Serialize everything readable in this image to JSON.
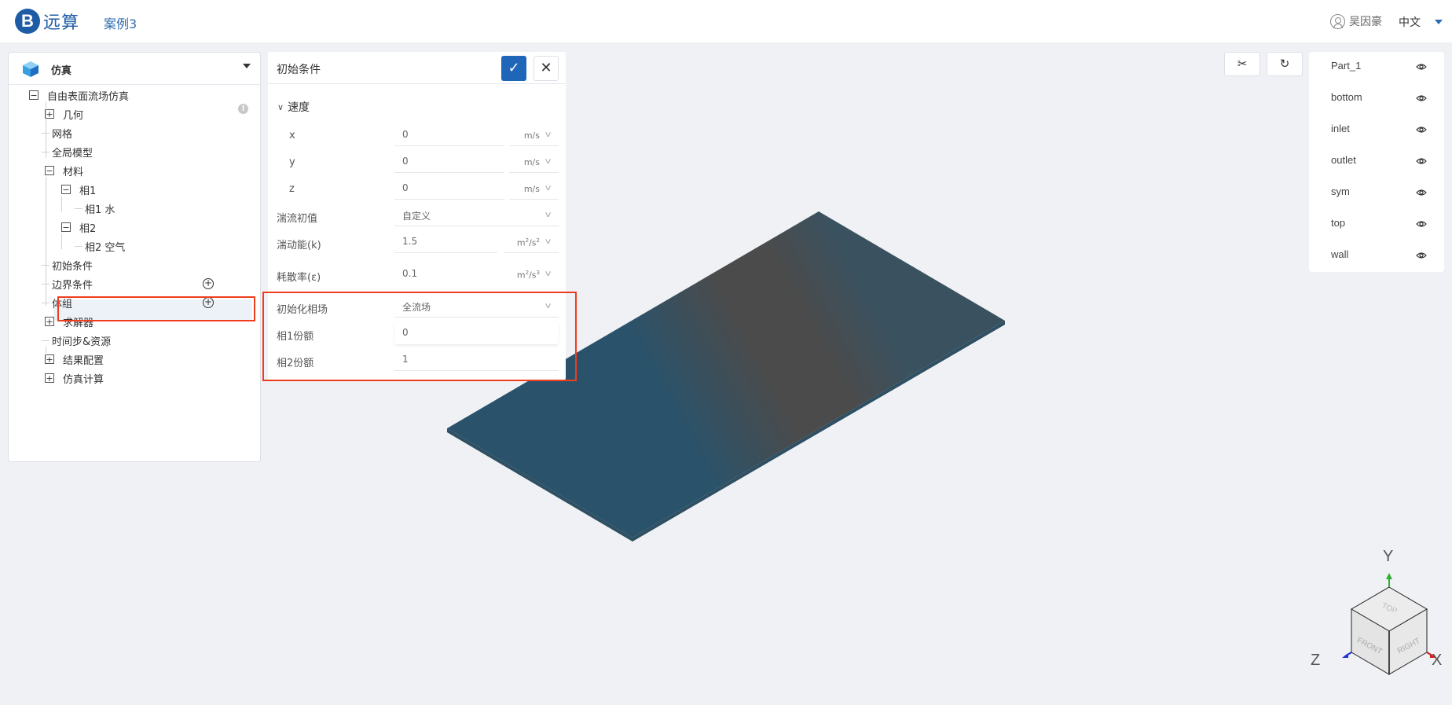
{
  "header": {
    "logo_mark": "B",
    "app_name": "远算",
    "project_name": "案例3",
    "user_name": "吴因豪",
    "language": "中文"
  },
  "left_panel": {
    "title": "仿真",
    "tree": [
      {
        "label": "自由表面流场仿真",
        "toggle": "−",
        "level": 0
      },
      {
        "label": "几何",
        "toggle": "+",
        "level": 1
      },
      {
        "label": "网格",
        "toggle": null,
        "level": 1
      },
      {
        "label": "全局模型",
        "toggle": null,
        "level": 1
      },
      {
        "label": "材料",
        "toggle": "−",
        "level": 1
      },
      {
        "label": "相1",
        "toggle": "−",
        "level": 2
      },
      {
        "label": "相1 水",
        "toggle": null,
        "level": 3
      },
      {
        "label": "相2",
        "toggle": "−",
        "level": 2
      },
      {
        "label": "相2 空气",
        "toggle": null,
        "level": 3
      },
      {
        "label": "初始条件",
        "toggle": null,
        "level": 1,
        "selected": true
      },
      {
        "label": "边界条件",
        "toggle": null,
        "level": 1,
        "action": "add"
      },
      {
        "label": "体组",
        "toggle": null,
        "level": 1,
        "action": "add"
      },
      {
        "label": "求解器",
        "toggle": "+",
        "level": 1
      },
      {
        "label": "时间步&资源",
        "toggle": null,
        "level": 1
      },
      {
        "label": "结果配置",
        "toggle": "+",
        "level": 1
      },
      {
        "label": "仿真计算",
        "toggle": "+",
        "level": 1
      }
    ],
    "info_badge": "!"
  },
  "form": {
    "title": "初始条件",
    "confirm_icon": "✓",
    "close_icon": "✕",
    "section_velocity": "速度",
    "velocity": [
      {
        "label": "x",
        "value": "0",
        "unit": "m/s"
      },
      {
        "label": "y",
        "value": "0",
        "unit": "m/s"
      },
      {
        "label": "z",
        "value": "0",
        "unit": "m/s"
      }
    ],
    "turbulence_init": {
      "label": "湍流初值",
      "value": "自定义"
    },
    "tke": {
      "label": "湍动能(k)",
      "value": "1.5",
      "unit_base": "m",
      "unit_exp1": "2",
      "unit_mid": "/s",
      "unit_exp2": "2"
    },
    "dissipation": {
      "label": "耗散率(ε)",
      "value": "0.1",
      "unit_base": "m",
      "unit_exp1": "2",
      "unit_mid": "/s",
      "unit_exp2": "3"
    },
    "phase_init": {
      "label": "初始化相场",
      "value": "全流场"
    },
    "phase1_fraction": {
      "label": "相1份额",
      "value": "0"
    },
    "phase2_fraction": {
      "label": "相2份额",
      "value": "1"
    }
  },
  "viewport": {
    "tools": [
      {
        "name": "clip",
        "icon": "✂"
      },
      {
        "name": "reset-view",
        "icon": "↻"
      }
    ],
    "parts": [
      "Part_1",
      "bottom",
      "inlet",
      "outlet",
      "sym",
      "top",
      "wall"
    ],
    "axes": {
      "x": "X",
      "y": "Y",
      "z": "Z"
    },
    "cube_faces": {
      "top": "TOP",
      "front": "FRONT",
      "right": "RIGHT"
    },
    "colors": {
      "plane_center": "#4b4b4b",
      "plane_edge": "#2a536b",
      "x_axis": "#d42020",
      "y_axis": "#2fb02f",
      "z_axis": "#1f2fd0"
    }
  },
  "colors": {
    "brand": "#1e5da5",
    "annotation_red": "#f03c1e",
    "background": "#eff1f5"
  }
}
